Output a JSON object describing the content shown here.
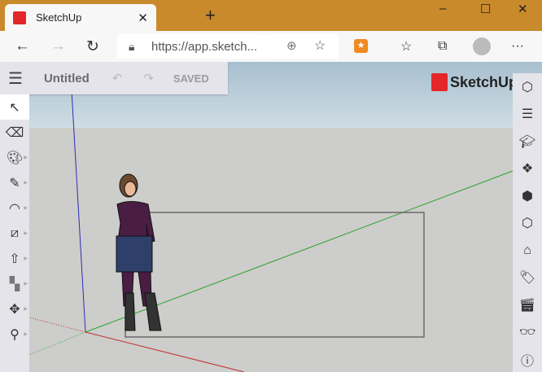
{
  "browser": {
    "tab_title": "SketchUp",
    "url": "https://app.sketch...",
    "window_controls": [
      "minimize",
      "maximize",
      "close"
    ]
  },
  "app": {
    "title": "Untitled",
    "status": "SAVED",
    "brand": "SketchUp"
  },
  "left_tools": [
    "select",
    "eraser",
    "paint-bucket",
    "pencil",
    "arc",
    "rectangle",
    "push-pull",
    "offset",
    "move",
    "tape-measure"
  ],
  "right_panels": [
    "entity-info",
    "outliner",
    "instructor",
    "materials",
    "components",
    "solid-inspector",
    "3d-warehouse",
    "tags",
    "scenes",
    "display",
    "model-info"
  ]
}
